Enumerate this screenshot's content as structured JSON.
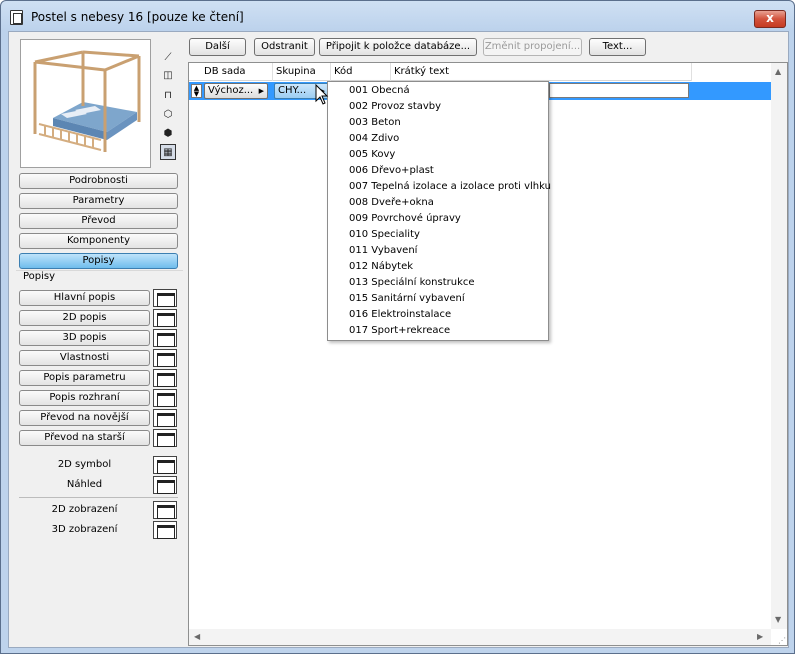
{
  "window": {
    "title": "Postel s nebesy 16 [pouze ke čtení]",
    "close_label": "x"
  },
  "view_icons": [
    "3d-axis-icon",
    "top-view-icon",
    "table-view-icon",
    "box-icon",
    "solid-box-icon",
    "filmstrip-icon"
  ],
  "nav": [
    {
      "label": "Podrobnosti"
    },
    {
      "label": "Parametry"
    },
    {
      "label": "Převod"
    },
    {
      "label": "Komponenty"
    },
    {
      "label": "Popisy",
      "active": true
    }
  ],
  "popisy": {
    "group_label": "Popisy",
    "items": [
      {
        "label": "Hlavní popis"
      },
      {
        "label": "2D popis"
      },
      {
        "label": "3D popis"
      },
      {
        "label": "Vlastnosti"
      },
      {
        "label": "Popis parametru"
      },
      {
        "label": "Popis rozhraní"
      },
      {
        "label": "Převod na novější"
      },
      {
        "label": "Převod na starší"
      }
    ]
  },
  "extra": [
    {
      "label": "2D symbol"
    },
    {
      "label": "Náhled"
    },
    {
      "label": "2D zobrazení"
    },
    {
      "label": "3D zobrazení"
    }
  ],
  "toolbar": {
    "next": "Další",
    "remove": "Odstranit",
    "attach": "Připojit k položce databáze...",
    "change_link": "Změnit propojení...",
    "text": "Text..."
  },
  "table": {
    "columns": [
      "DB sada",
      "Skupina",
      "Kód",
      "Krátký text"
    ],
    "row": {
      "db_set": "Výchoz...",
      "group": "CHY..."
    }
  },
  "dropdown": [
    {
      "code": "001",
      "name": "Obecná"
    },
    {
      "code": "002",
      "name": "Provoz stavby"
    },
    {
      "code": "003",
      "name": "Beton"
    },
    {
      "code": "004",
      "name": "Zdivo"
    },
    {
      "code": "005",
      "name": "Kovy"
    },
    {
      "code": "006",
      "name": "Dřevo+plast"
    },
    {
      "code": "007",
      "name": "Tepelná izolace a izolace proti vlhku"
    },
    {
      "code": "008",
      "name": "Dveře+okna"
    },
    {
      "code": "009",
      "name": "Povrchové úpravy"
    },
    {
      "code": "010",
      "name": "Speciality"
    },
    {
      "code": "011",
      "name": "Vybavení"
    },
    {
      "code": "012",
      "name": "Nábytek"
    },
    {
      "code": "013",
      "name": "Speciální konstrukce"
    },
    {
      "code": "015",
      "name": "Sanitární vybavení"
    },
    {
      "code": "016",
      "name": "Elektroinstalace"
    },
    {
      "code": "017",
      "name": "Sport+rekreace"
    }
  ],
  "colors": {
    "selection": "#3399ff",
    "active_nav": "#6fbdec",
    "close": "#c53a22"
  }
}
